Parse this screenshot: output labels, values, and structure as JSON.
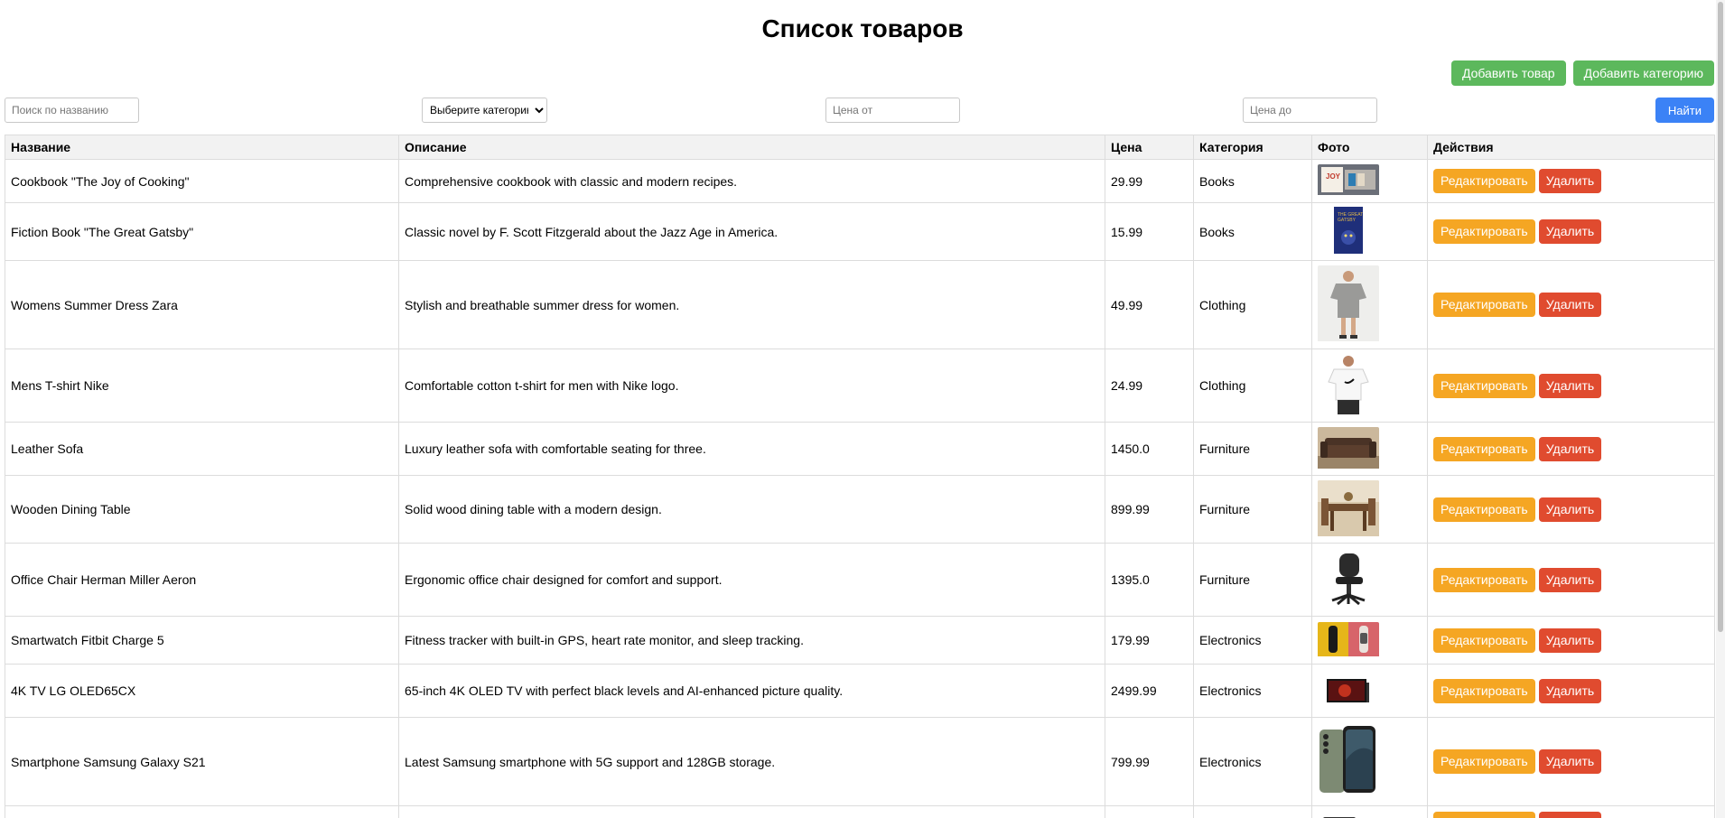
{
  "page": {
    "title": "Список товаров"
  },
  "toolbar": {
    "add_product_label": "Добавить товар",
    "add_category_label": "Добавить категорию"
  },
  "filters": {
    "name_placeholder": "Поиск по названию",
    "category_selected": "Выберите категорию",
    "price_from_placeholder": "Цена от",
    "price_to_placeholder": "Цена до",
    "find_label": "Найти"
  },
  "table": {
    "headers": {
      "name": "Название",
      "description": "Описание",
      "price": "Цена",
      "category": "Категория",
      "photo": "Фото",
      "actions": "Действия"
    },
    "edit_label": "Редактировать",
    "delete_label": "Удалить",
    "rows": [
      {
        "name": "Cookbook \"The Joy of Cooking\"",
        "description": "Comprehensive cookbook with classic and modern recipes.",
        "price": "29.99",
        "category": "Books",
        "photo": "cookbook-photo"
      },
      {
        "name": "Fiction Book \"The Great Gatsby\"",
        "description": "Classic novel by F. Scott Fitzgerald about the Jazz Age in America.",
        "price": "15.99",
        "category": "Books",
        "photo": "book-cover-photo"
      },
      {
        "name": "Womens Summer Dress Zara",
        "description": "Stylish and breathable summer dress for women.",
        "price": "49.99",
        "category": "Clothing",
        "photo": "dress-photo"
      },
      {
        "name": "Mens T-shirt Nike",
        "description": "Comfortable cotton t-shirt for men with Nike logo.",
        "price": "24.99",
        "category": "Clothing",
        "photo": "tshirt-photo"
      },
      {
        "name": "Leather Sofa",
        "description": "Luxury leather sofa with comfortable seating for three.",
        "price": "1450.0",
        "category": "Furniture",
        "photo": "sofa-photo"
      },
      {
        "name": "Wooden Dining Table",
        "description": "Solid wood dining table with a modern design.",
        "price": "899.99",
        "category": "Furniture",
        "photo": "dining-table-photo"
      },
      {
        "name": "Office Chair Herman Miller Aeron",
        "description": "Ergonomic office chair designed for comfort and support.",
        "price": "1395.0",
        "category": "Furniture",
        "photo": "office-chair-photo"
      },
      {
        "name": "Smartwatch Fitbit Charge 5",
        "description": "Fitness tracker with built-in GPS, heart rate monitor, and sleep tracking.",
        "price": "179.99",
        "category": "Electronics",
        "photo": "smartwatch-photo"
      },
      {
        "name": "4K TV LG OLED65CX",
        "description": "65-inch 4K OLED TV with perfect black levels and AI-enhanced picture quality.",
        "price": "2499.99",
        "category": "Electronics",
        "photo": "tv-photo"
      },
      {
        "name": "Smartphone Samsung Galaxy S21",
        "description": "Latest Samsung smartphone with 5G support and 128GB storage.",
        "price": "799.99",
        "category": "Electronics",
        "photo": "smartphone-photo"
      },
      {
        "name": "",
        "description": "",
        "price": "",
        "category": "",
        "photo": "laptop-photo"
      }
    ]
  },
  "colors": {
    "green": "#5cb85c",
    "blue": "#3b82f6",
    "orange": "#f5a623",
    "red": "#e04b2f"
  }
}
